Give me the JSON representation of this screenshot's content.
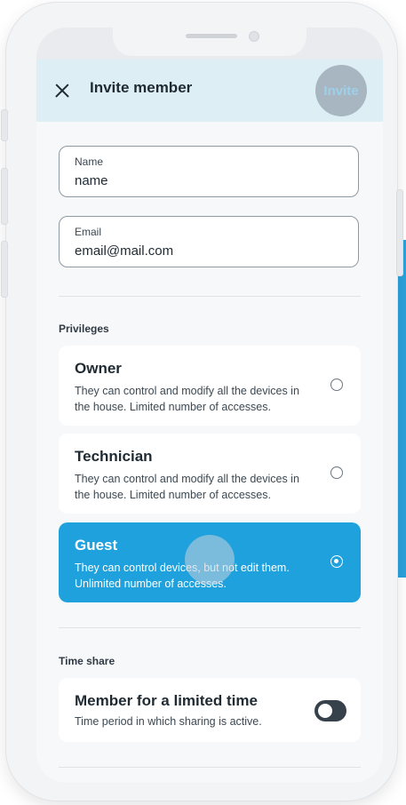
{
  "appbar": {
    "title": "Invite member",
    "action_label": "Invite"
  },
  "form": {
    "name": {
      "label": "Name",
      "value": "name"
    },
    "email": {
      "label": "Email",
      "value": "email@mail.com"
    }
  },
  "privileges": {
    "heading": "Privileges",
    "options": [
      {
        "title": "Owner",
        "description": "They can control and modify all the devices in the house. Limited number of accesses.",
        "selected": false
      },
      {
        "title": "Technician",
        "description": "They can control and modify all the devices in the house. Limited number of accesses.",
        "selected": false
      },
      {
        "title": "Guest",
        "description": "They can control devices, but not edit them. Unlimited number of accesses.",
        "selected": true
      }
    ]
  },
  "time_share": {
    "heading": "Time share",
    "item": {
      "title": "Member for a limited time",
      "description": "Time period in which sharing is active.",
      "enabled": false
    }
  },
  "colors": {
    "accent": "#1ea1dc",
    "appbar_bg": "#ddeef5",
    "text": "#1f2a33"
  }
}
